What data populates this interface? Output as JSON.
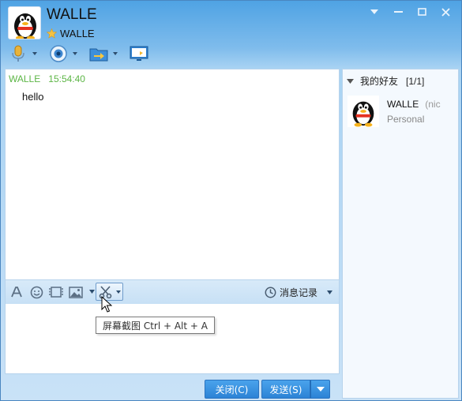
{
  "header": {
    "name": "WALLE",
    "status_text": "WALLE"
  },
  "toolbar": {
    "items": [
      {
        "icon": "microphone-icon"
      },
      {
        "icon": "camera-icon"
      },
      {
        "icon": "file-transfer-icon"
      },
      {
        "icon": "screen-share-icon"
      }
    ]
  },
  "chat": {
    "messages": [
      {
        "sender": "WALLE",
        "time": "15:54:40",
        "text": "hello"
      }
    ]
  },
  "input_toolbar": {
    "history_label": "消息记录"
  },
  "tooltip": {
    "text": "屏幕截图 Ctrl + Alt + A"
  },
  "buttons": {
    "close_label": "关闭(C)",
    "send_label": "发送(S)"
  },
  "friends": {
    "group_name": "我的好友",
    "group_count": "[1/1]",
    "list": [
      {
        "name": "WALLE",
        "note": "(nic",
        "signature": "Personal"
      }
    ]
  },
  "colors": {
    "accent": "#2c83d6",
    "message_header": "#5db646",
    "title_bar": "#4fa3e4"
  }
}
